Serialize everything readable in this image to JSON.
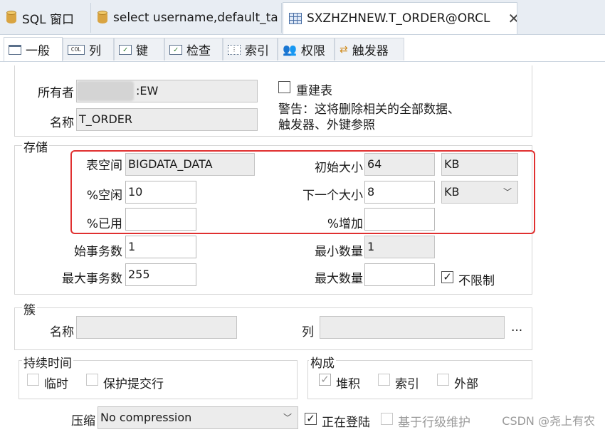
{
  "doc_tabs": [
    {
      "label": "SQL 窗口"
    },
    {
      "label": "select username,default_ta ..."
    },
    {
      "label": "SXZHZHNEW.T_ORDER@ORCL"
    }
  ],
  "sub_tabs": [
    {
      "label": "一般",
      "icon": "window-icon"
    },
    {
      "label": "列",
      "icon": "col-icon",
      "icon_text": "COL"
    },
    {
      "label": "键",
      "icon": "key-check-icon"
    },
    {
      "label": "检查",
      "icon": "check-icon"
    },
    {
      "label": "索引",
      "icon": "index-icon"
    },
    {
      "label": "权限",
      "icon": "users-icon"
    },
    {
      "label": "触发器",
      "icon": "trigger-icon"
    }
  ],
  "general": {
    "owner_label": "所有者",
    "owner_value": ":EW",
    "name_label": "名称",
    "name_value": "T_ORDER",
    "rebuild_label": "重建表",
    "warning_line1": "警告：这将删除相关的全部数据、",
    "warning_line2": "触发器、外键参照"
  },
  "storage": {
    "title": "存储",
    "tablespace_label": "表空间",
    "tablespace_value": "BIGDATA_DATA",
    "initial_size_label": "初始大小",
    "initial_size_value": "64",
    "initial_size_unit": "KB",
    "pctfree_label": "%空闲",
    "pctfree_value": "10",
    "next_size_label": "下一个大小",
    "next_size_value": "8",
    "next_size_unit": "KB",
    "pctused_label": "%已用",
    "pctused_value": "",
    "pctincrease_label": "%增加",
    "pctincrease_value": "",
    "initrans_label": "始事务数",
    "initrans_value": "1",
    "min_extents_label": "最小数量",
    "min_extents_value": "1",
    "maxtrans_label": "最大事务数",
    "maxtrans_value": "255",
    "max_extents_label": "最大数量",
    "max_extents_value": "",
    "unlimited_label": "不限制",
    "unlimited_checked": true
  },
  "cluster": {
    "title": "簇",
    "name_label": "名称",
    "name_value": "",
    "columns_label": "列",
    "columns_value": "",
    "browse_label": "..."
  },
  "duration": {
    "title": "持续时间",
    "temporary_label": "临时",
    "preserve_label": "保护提交行"
  },
  "organization": {
    "title": "构成",
    "heap_label": "堆积",
    "index_label": "索引",
    "external_label": "外部"
  },
  "compression_label": "压缩",
  "compression_value": "No compression",
  "logging_label": "正在登陆",
  "logging_checked": true,
  "row_movement_label": "基于行级维护",
  "watermark": "CSDN @尧上有农"
}
